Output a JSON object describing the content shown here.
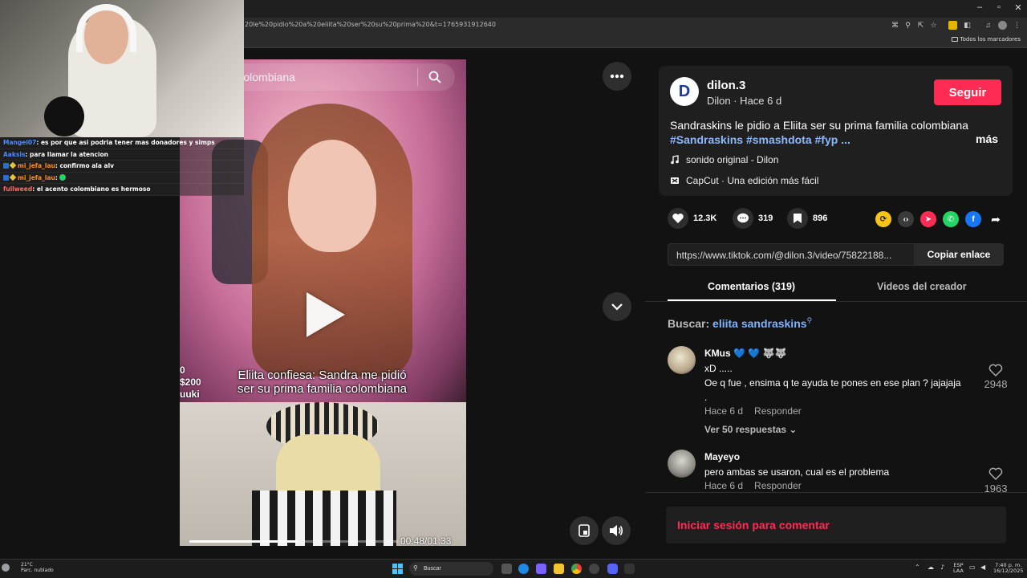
{
  "browser": {
    "url": "20le%20pidio%20a%20eliita%20ser%20su%20prima%20&t=1765931912640",
    "bookmarks_label": "Todos los marcadores",
    "window_controls": [
      "–",
      "▫",
      "✕"
    ]
  },
  "stream": {
    "chat": [
      {
        "user": "Mangel07",
        "user_color": "#4a8cff",
        "message": ": es por que asi podria tener mas donadores y simps"
      },
      {
        "user": "Aaksis",
        "user_color": "#4a8cff",
        "message": ": para llamar la atencion"
      },
      {
        "user": "mi_jefa_lau",
        "user_color": "#ff8c1a",
        "message": ": confirmo ala alv",
        "badges": true
      },
      {
        "user": "mi_jefa_lau",
        "user_color": "#ff8c1a",
        "message": ":",
        "badges": true,
        "emote": true
      },
      {
        "user": "fullweed",
        "user_color": "#ff6b6b",
        "message": ": el acento colombiano es hermoso"
      }
    ]
  },
  "video": {
    "search_text": "kins no era colombiana",
    "caption": "Eliita confiesa: Sandra me pidió ser su prima familia colombiana",
    "overlay_left": [
      "0",
      "$200",
      "uuki"
    ],
    "current_time": "00:48",
    "duration": "01:33",
    "time_display": "00:48/01:33",
    "progress_fraction": 0.52
  },
  "post": {
    "avatar_letter": "D",
    "username": "dilon.3",
    "subline": "Dilon · Hace 6 d",
    "follow_label": "Seguir",
    "description": "Sandraskins le pidio a Eliita ser su prima familia colombiana",
    "hashtags": "#Sandraskins #smashdota #fyp ...",
    "more_label": "más",
    "sound": "sonido original - Dilon",
    "capcut": "CapCut · Una edición más fácil"
  },
  "actions": {
    "likes": "12.3K",
    "comments": "319",
    "saves": "896"
  },
  "link": {
    "url": "https://www.tiktok.com/@dilon.3/video/75822188...",
    "copy_label": "Copiar enlace"
  },
  "tabs": [
    {
      "label": "Comentarios (319)",
      "active": true
    },
    {
      "label": "Videos del creador",
      "active": false
    }
  ],
  "search": {
    "prefix": "Buscar:",
    "query": "eliita sandraskins"
  },
  "comments": [
    {
      "name": "KMus 💙 💙 🐺🐺",
      "lines": [
        "xD .....",
        "Oe q fue , ensima q te ayuda te pones en ese plan ? jajajaja",
        "."
      ],
      "time": "Hace 6 d",
      "reply_label": "Responder",
      "likes": "2948",
      "replies_label": "Ver 50 respuestas"
    },
    {
      "name": "Mayeyo",
      "lines": [
        "pero ambas se usaron, cual es el problema"
      ],
      "time": "Hace 6 d",
      "reply_label": "Responder",
      "likes": "1963"
    }
  ],
  "login_prompt": "Iniciar sesión para comentar",
  "taskbar": {
    "temperature": "21°C",
    "weather": "Parc. nublado",
    "search_placeholder": "Buscar",
    "lang": "ESP",
    "lang2": "LAA",
    "time": "7:40 p. m.",
    "date": "16/12/2025"
  }
}
